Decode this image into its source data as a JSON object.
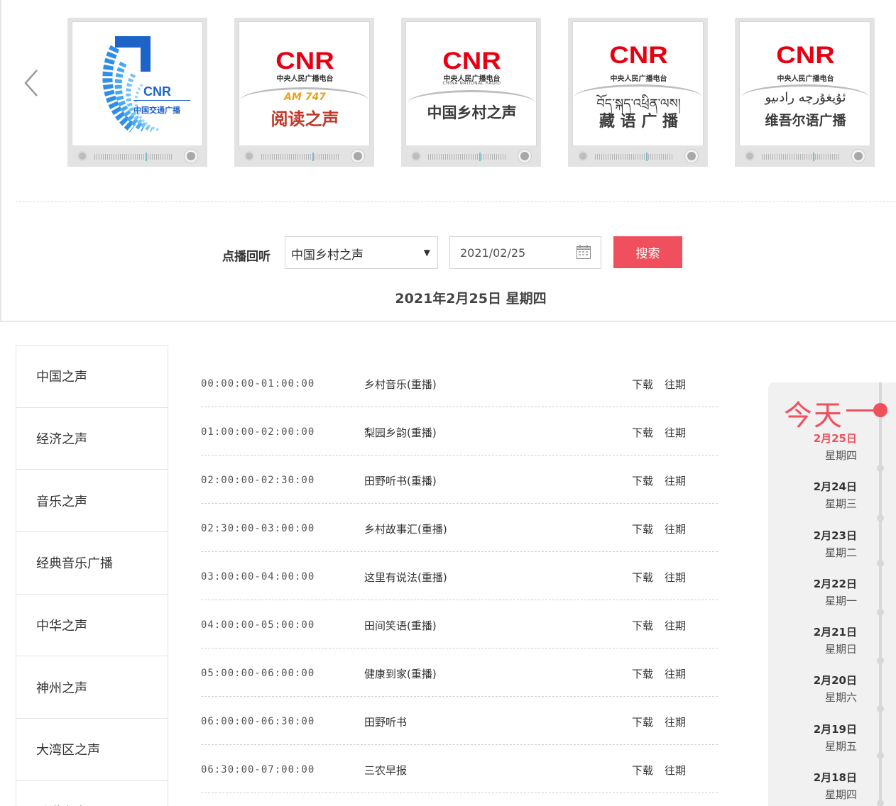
{
  "carousel": {
    "cards": [
      {
        "id": "traffic",
        "cnr": "CNR",
        "sub": "中国交通广播"
      },
      {
        "id": "reading",
        "cnr": "CNR",
        "sub": "中央人民广播电台",
        "band": "AM 747",
        "name": "阅读之声"
      },
      {
        "id": "rural",
        "cnr": "CNR",
        "sub": "中央人民广播电台",
        "sub_en": "CHINA NATIONAL RADIO",
        "name": "中国乡村之声"
      },
      {
        "id": "tibetan",
        "cnr": "CNR",
        "sub": "中央人民广播电台",
        "script": "བོད་སྐད་འཕྲིན་ལས།",
        "name": "藏 语 广 播"
      },
      {
        "id": "uyghur",
        "cnr": "CNR",
        "sub": "中央人民广播电台",
        "script": "ئۇيغۇرچە رادىيو",
        "name": "维吾尔语广播"
      }
    ]
  },
  "search": {
    "label": "点播回听",
    "selected_channel": "中国乡村之声",
    "date_value": "2021/02/25",
    "button_label": "搜索"
  },
  "date_heading": "2021年2月25日  星期四",
  "sidebar": {
    "items": [
      "中国之声",
      "经济之声",
      "音乐之声",
      "经典音乐广播",
      "中华之声",
      "神州之声",
      "大湾区之声",
      "香港之声"
    ]
  },
  "programs": [
    {
      "time": "00:00:00-01:00:00",
      "title": "乡村音乐(重播)",
      "download": "下载",
      "past": "往期"
    },
    {
      "time": "01:00:00-02:00:00",
      "title": "梨园乡韵(重播)",
      "download": "下载",
      "past": "往期"
    },
    {
      "time": "02:00:00-02:30:00",
      "title": "田野听书(重播)",
      "download": "下载",
      "past": "往期"
    },
    {
      "time": "02:30:00-03:00:00",
      "title": "乡村故事汇(重播)",
      "download": "下载",
      "past": "往期"
    },
    {
      "time": "03:00:00-04:00:00",
      "title": "这里有说法(重播)",
      "download": "下载",
      "past": "往期"
    },
    {
      "time": "04:00:00-05:00:00",
      "title": "田间笑语(重播)",
      "download": "下载",
      "past": "往期"
    },
    {
      "time": "05:00:00-06:00:00",
      "title": "健康到家(重播)",
      "download": "下载",
      "past": "往期"
    },
    {
      "time": "06:00:00-06:30:00",
      "title": "田野听书",
      "download": "下载",
      "past": "往期"
    },
    {
      "time": "06:30:00-07:00:00",
      "title": "三农早报",
      "download": "下载",
      "past": "往期"
    }
  ],
  "timeline": {
    "today_label": "今天",
    "dates": [
      {
        "date": "2月25日",
        "week": "星期四",
        "active": true
      },
      {
        "date": "2月24日",
        "week": "星期三"
      },
      {
        "date": "2月23日",
        "week": "星期二"
      },
      {
        "date": "2月22日",
        "week": "星期一"
      },
      {
        "date": "2月21日",
        "week": "星期日"
      },
      {
        "date": "2月20日",
        "week": "星期六"
      },
      {
        "date": "2月19日",
        "week": "星期五"
      },
      {
        "date": "2月18日",
        "week": "星期四"
      }
    ]
  },
  "colors": {
    "accent": "#f0505d",
    "cnr_red": "#e60012",
    "traffic_blue": "#1e64c8"
  }
}
